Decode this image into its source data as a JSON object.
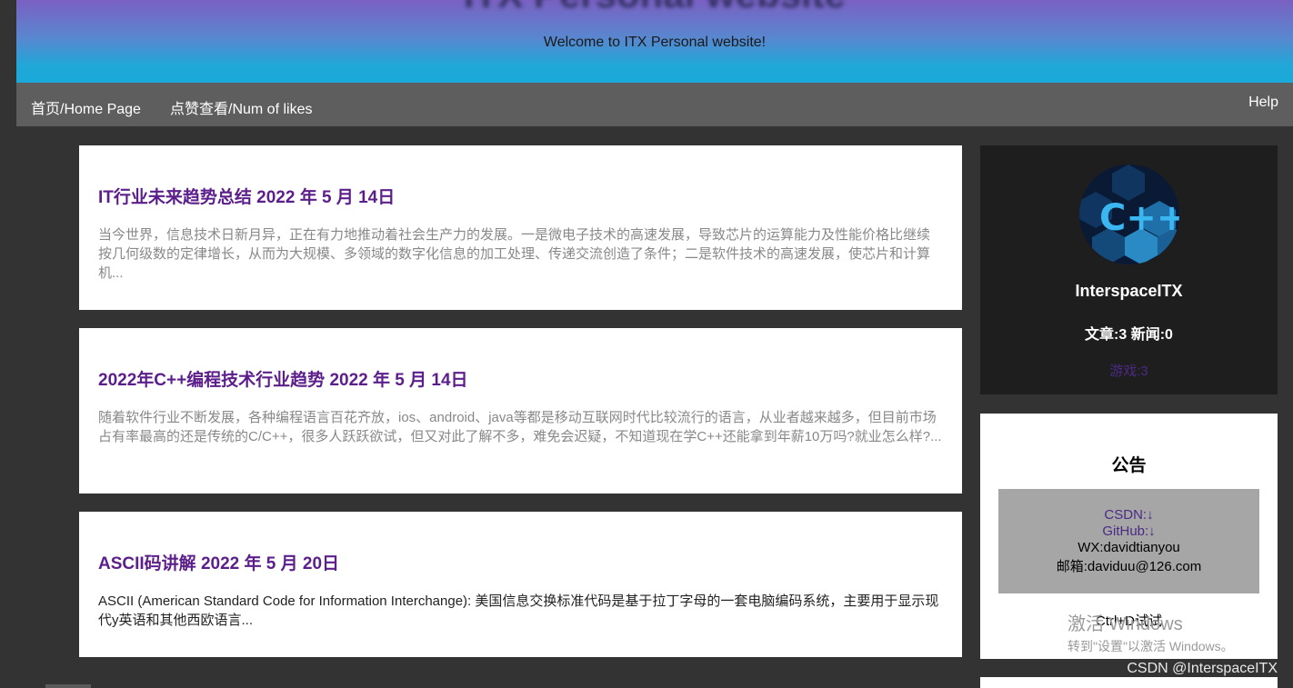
{
  "header": {
    "title": "ITX Personal website",
    "subtitle": "Welcome to ITX Personal website!"
  },
  "nav": {
    "home": "首页/Home Page",
    "likes": "点赞查看/Num of likes",
    "help": "Help"
  },
  "articles": [
    {
      "title": "IT行业未来趋势总结 2022 年 5 月 14日",
      "excerpt": "当今世界，信息技术日新月异，正在有力地推动着社会生产力的发展。一是微电子技术的高速发展，导致芯片的运算能力及性能价格比继续按几何级数的定律增长，从而为大规模、多领域的数字化信息的加工处理、传递交流创造了条件；二是软件技术的高速发展，使芯片和计算机..."
    },
    {
      "title": "2022年C++编程技术行业趋势 2022 年 5 月 14日",
      "excerpt": "随着软件行业不断发展，各种编程语言百花齐放，ios、android、java等都是移动互联网时代比较流行的语言，从业者越来越多，但目前市场占有率最高的还是传统的C/C++，很多人跃跃欲试，但又对此了解不多，难免会迟疑，不知道现在学C++还能拿到年薪10万吗?就业怎么样?..."
    },
    {
      "title": "ASCII码讲解 2022 年 5 月 20日",
      "excerpt": "ASCII (American Standard Code for Information Interchange): 美国信息交换标准代码是基于拉丁字母的一套电脑编码系统，主要用于显示现代y英语和其他西欧语言..."
    }
  ],
  "profile": {
    "avatar_icon": "cpp-logo-icon",
    "avatar_text": "C++",
    "name": "InterspaceITX",
    "stats": "文章:3 新闻:0",
    "games": "游戏:3"
  },
  "notice": {
    "title": "公告",
    "csdn": "CSDN:↓",
    "github": "GitHub:↓",
    "wx": "WX:davidtianyou",
    "email": "邮箱:daviduu@126.com",
    "ctrl": "Ctrl+D试试"
  },
  "overlay": {
    "windows_title": "激活 Windows",
    "windows_sub": "转到\"设置\"以激活 Windows。",
    "watermark": "CSDN @InterspaceITX"
  },
  "colors": {
    "link_purple": "#5b1e8a",
    "background": "#333333",
    "nav_bg": "#5e5e5e"
  }
}
